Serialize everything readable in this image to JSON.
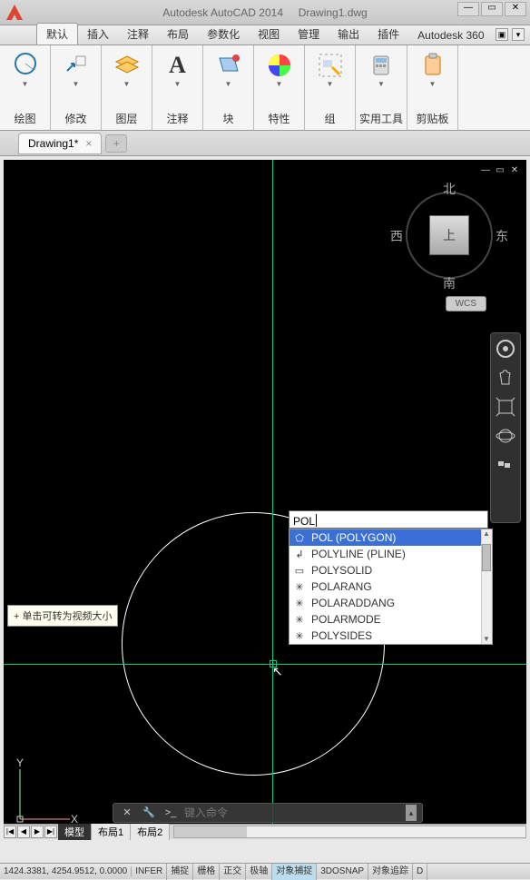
{
  "titlebar": {
    "app_title": "Autodesk AutoCAD 2014",
    "doc_title": "Drawing1.dwg"
  },
  "ribbon_tabs": {
    "items": [
      "默认",
      "插入",
      "注释",
      "布局",
      "参数化",
      "视图",
      "管理",
      "输出",
      "插件",
      "Autodesk 360"
    ]
  },
  "ribbon_panels": [
    "绘图",
    "修改",
    "图层",
    "注释",
    "块",
    "特性",
    "组",
    "实用工具",
    "剪贴板"
  ],
  "file_tab": {
    "label": "Drawing1*"
  },
  "viewcube": {
    "n": "北",
    "s": "南",
    "e": "东",
    "w": "西",
    "top": "上",
    "wcs": "WCS"
  },
  "tooltip": "+ 单击可转为视频大小",
  "cmd_typed": "POL",
  "autocomplete": {
    "items": [
      {
        "label": "POL (POLYGON)",
        "icon": "⬠"
      },
      {
        "label": "POLYLINE (PLINE)",
        "icon": "↲"
      },
      {
        "label": "POLYSOLID",
        "icon": "▭"
      },
      {
        "label": "POLARANG",
        "icon": "✳"
      },
      {
        "label": "POLARADDANG",
        "icon": "✳"
      },
      {
        "label": "POLARMODE",
        "icon": "✳"
      },
      {
        "label": "POLYSIDES",
        "icon": "✳"
      }
    ]
  },
  "cmdline": {
    "placeholder": "键入命令"
  },
  "layout_tabs": [
    "模型",
    "布局1",
    "布局2"
  ],
  "status": {
    "coords": "1424.3381, 4254.9512, 0.0000",
    "buttons": [
      "INFER",
      "捕捉",
      "栅格",
      "正交",
      "极轴",
      "对象捕捉",
      "3DOSNAP",
      "对象追踪",
      "D"
    ],
    "on_idx": [
      5
    ]
  }
}
